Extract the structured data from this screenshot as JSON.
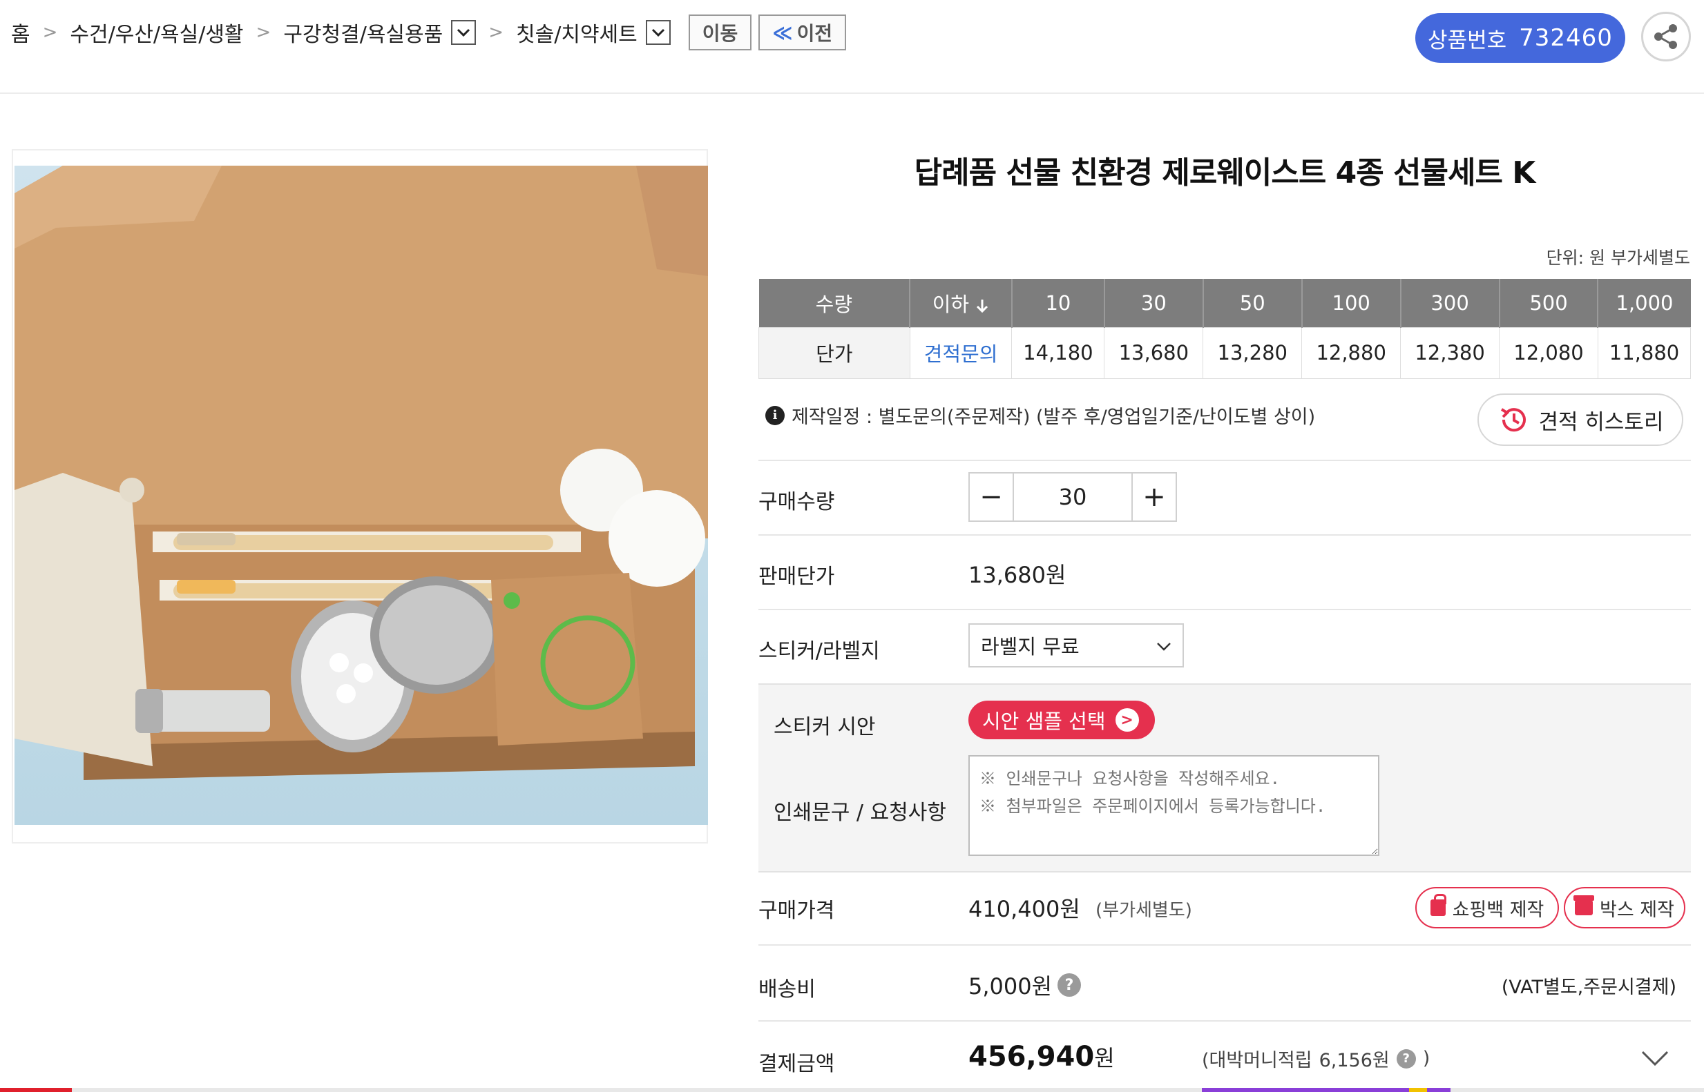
{
  "breadcrumb": {
    "home": "홈",
    "level1": "수건/우산/욕실/생활",
    "level2": "구강청결/욕실용품",
    "level3": "칫솔/치약세트",
    "move_button": "이동",
    "prev_button": "이전",
    "prev_prefix": "≪"
  },
  "product_number": {
    "label": "상품번호",
    "value": "732460"
  },
  "product": {
    "title": "답례품 선물 친환경 제로웨이스트 4종 선물세트 K",
    "unit_note": "단위: 원 부가세별도"
  },
  "price_table": {
    "row_header_qty": "수량",
    "row_header_price": "단가",
    "below_label": "이하",
    "quantities": [
      "10",
      "30",
      "50",
      "100",
      "300",
      "500",
      "1,000"
    ],
    "ask_label": "견적문의",
    "prices": [
      "14,180",
      "13,680",
      "13,280",
      "12,880",
      "12,380",
      "12,080",
      "11,880"
    ]
  },
  "schedule_note": "제작일정 : 별도문의(주문제작) (발주 후/영업일기준/난이도별 상이)",
  "quote_history_button": "견적 히스토리",
  "form": {
    "purchase_qty_label": "구매수량",
    "purchase_qty_value": "30",
    "minus": "−",
    "plus": "+",
    "unit_price_label": "판매단가",
    "unit_price_value": "13,680원",
    "sticker_label": "스티커/라벨지",
    "sticker_selected": "라벨지 무료",
    "sticker_preview_label": "스티커 시안",
    "sample_button": "시안 샘플 선택",
    "print_request_label": "인쇄문구 / 요청사항",
    "print_request_placeholder": "※ 인쇄문구나 요청사항을 작성해주세요.\n※ 첨부파일은 주문페이지에서 등록가능합니다.",
    "purchase_price_label": "구매가격",
    "purchase_price_value": "410,400원",
    "purchase_price_vat": "(부가세별도)",
    "shopping_bag_button": "쇼핑백 제작",
    "box_button": "박스 제작",
    "shipping_label": "배송비",
    "shipping_value": "5,000원",
    "shipping_note": "(VAT별도,주문시결제)",
    "total_label": "결제금액",
    "total_value": "456,940",
    "total_unit": "원",
    "point_label": "(대박머니적립",
    "point_value": "6,156원",
    "point_close": ")"
  },
  "colors": {
    "accent_blue": "#4468dc",
    "accent_red": "#e5304e",
    "table_header": "#7d7d7d",
    "link_blue": "#2f6fd0"
  },
  "icons": {
    "share": "share-icon",
    "history": "history-icon",
    "info": "info-icon",
    "help": "question-icon",
    "chevron": "chevron-down-icon"
  }
}
